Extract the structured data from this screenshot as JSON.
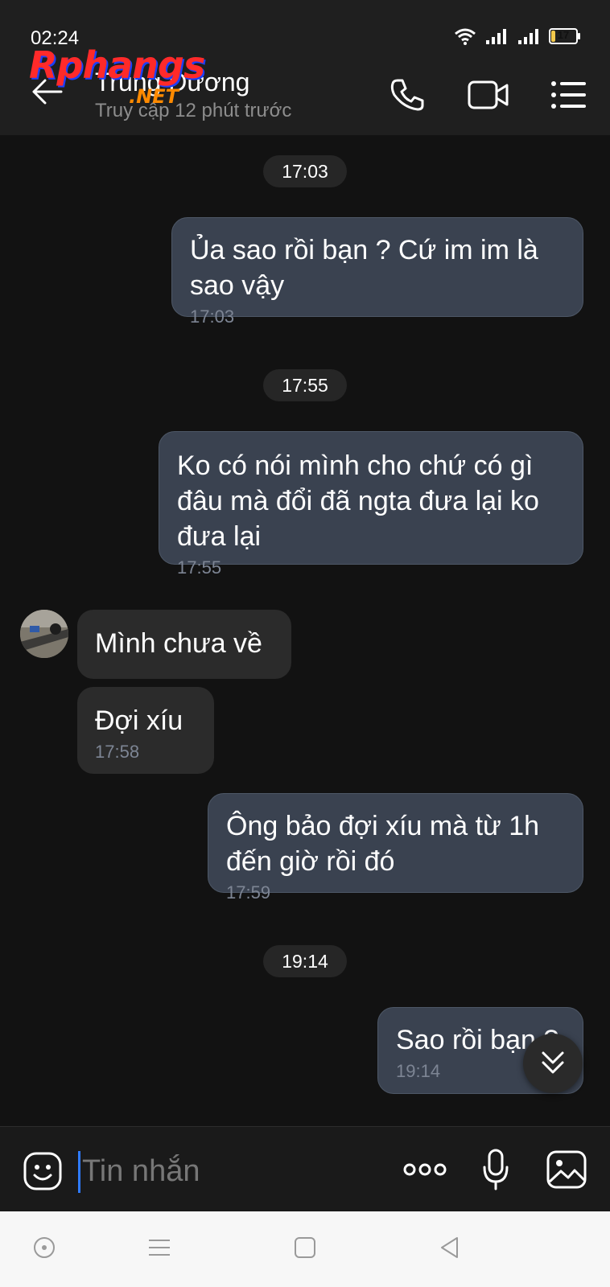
{
  "status_bar": {
    "time": "02:24",
    "battery": "17",
    "battery_level": 0.17
  },
  "header": {
    "contact_name": "Trung Dương",
    "last_seen": "Truy cập 12 phút trước",
    "watermark": {
      "main": "Rphangs",
      "suffix": ".NET"
    }
  },
  "messages": [
    {
      "type": "time",
      "text": "17:03"
    },
    {
      "type": "out",
      "text": "Ủa sao rồi bạn ? Cứ im im là sao vậy",
      "time": "17:03"
    },
    {
      "type": "time",
      "text": "17:55"
    },
    {
      "type": "out",
      "text": "Ko có nói mình cho chứ có gì đâu mà đổi đã ngta đưa lại ko đưa lại",
      "time": "17:55"
    },
    {
      "type": "in",
      "text": "Mình chưa về"
    },
    {
      "type": "in",
      "text": "Đợi xíu",
      "time": "17:58"
    },
    {
      "type": "out",
      "text": "Ông bảo đợi xíu mà từ 1h đến giờ rồi đó",
      "time": "17:59"
    },
    {
      "type": "time",
      "text": "19:14"
    },
    {
      "type": "out",
      "text": "Sao rồi bạn ?",
      "time": "19:14"
    }
  ],
  "composer": {
    "placeholder": "Tin nhắn"
  },
  "icons": {
    "back": "arrow-left-icon",
    "call": "phone-icon",
    "video": "video-camera-icon",
    "menu": "list-menu-icon",
    "emoji": "smiley-icon",
    "more": "more-dots-icon",
    "mic": "microphone-icon",
    "gallery": "image-icon",
    "scroll": "chevron-double-down-icon"
  },
  "colors": {
    "outgoing_bubble": "#3a4250",
    "incoming_bubble": "#2b2b2b",
    "background": "#121212",
    "cursor": "#2f7bff"
  }
}
